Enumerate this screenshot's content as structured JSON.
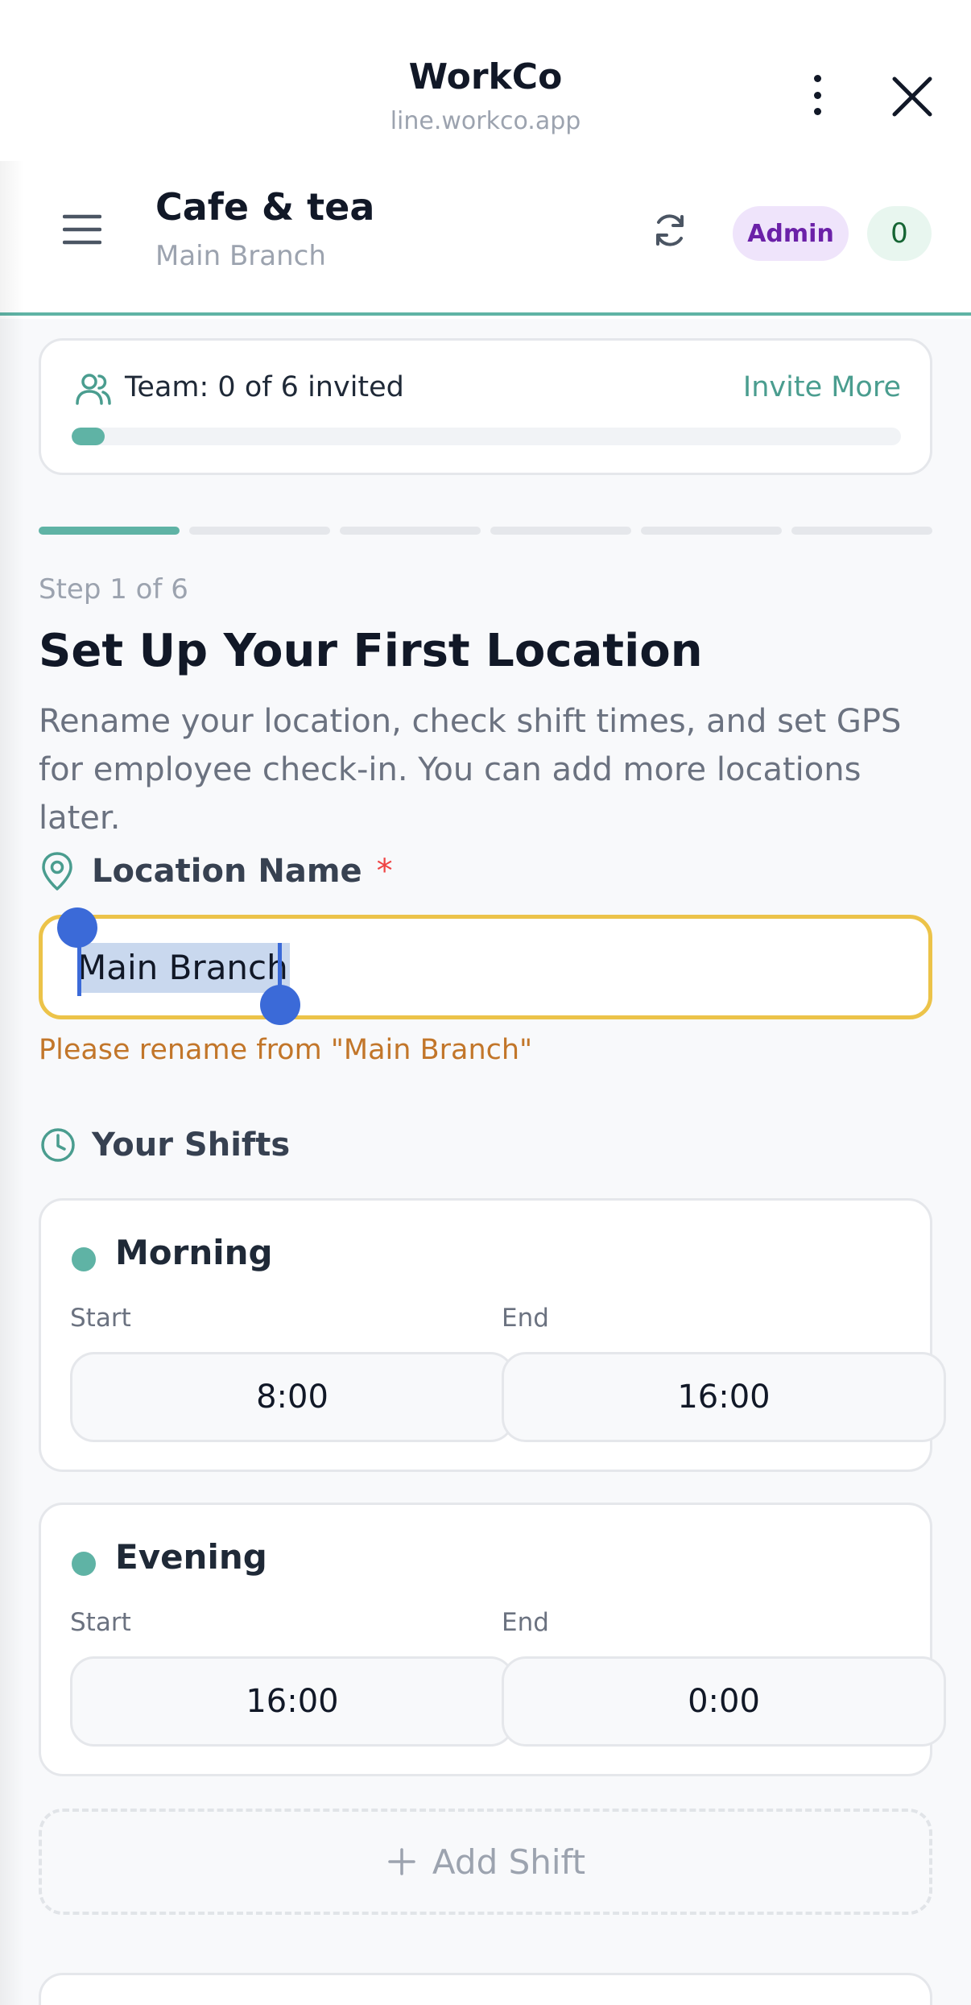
{
  "browser": {
    "title": "WorkCo",
    "url": "line.workco.app",
    "more_icon": "more-vertical-icon",
    "close_icon": "close-icon"
  },
  "header": {
    "org_name": "Cafe & tea",
    "branch_name": "Main Branch",
    "role_badge": "Admin",
    "count_badge": "0",
    "accent_color": "#5fb3a5"
  },
  "team": {
    "status": "Team: 0 of 6 invited",
    "invite_label": "Invite More",
    "invited": 0,
    "total": 6,
    "progress_fraction": 0.04
  },
  "stepper": {
    "total_steps": 6,
    "current_step": 1
  },
  "step": {
    "label": "Step 1 of 6",
    "title": "Set Up Your First Location",
    "description": "Rename your location, check shift times, and set GPS for employee check-in. You can add more locations later."
  },
  "location": {
    "label": "Location Name",
    "required_mark": "*",
    "value": "Main Branch",
    "warning": "Please rename from \"Main Branch\"",
    "warning_color": "#c2762a",
    "border_color": "#ecc349"
  },
  "shifts": {
    "label": "Your Shifts",
    "start_label": "Start",
    "end_label": "End",
    "items": [
      {
        "name": "Morning",
        "start": "8:00",
        "end": "16:00"
      },
      {
        "name": "Evening",
        "start": "16:00",
        "end": "0:00"
      }
    ],
    "add_label": "Add Shift"
  }
}
